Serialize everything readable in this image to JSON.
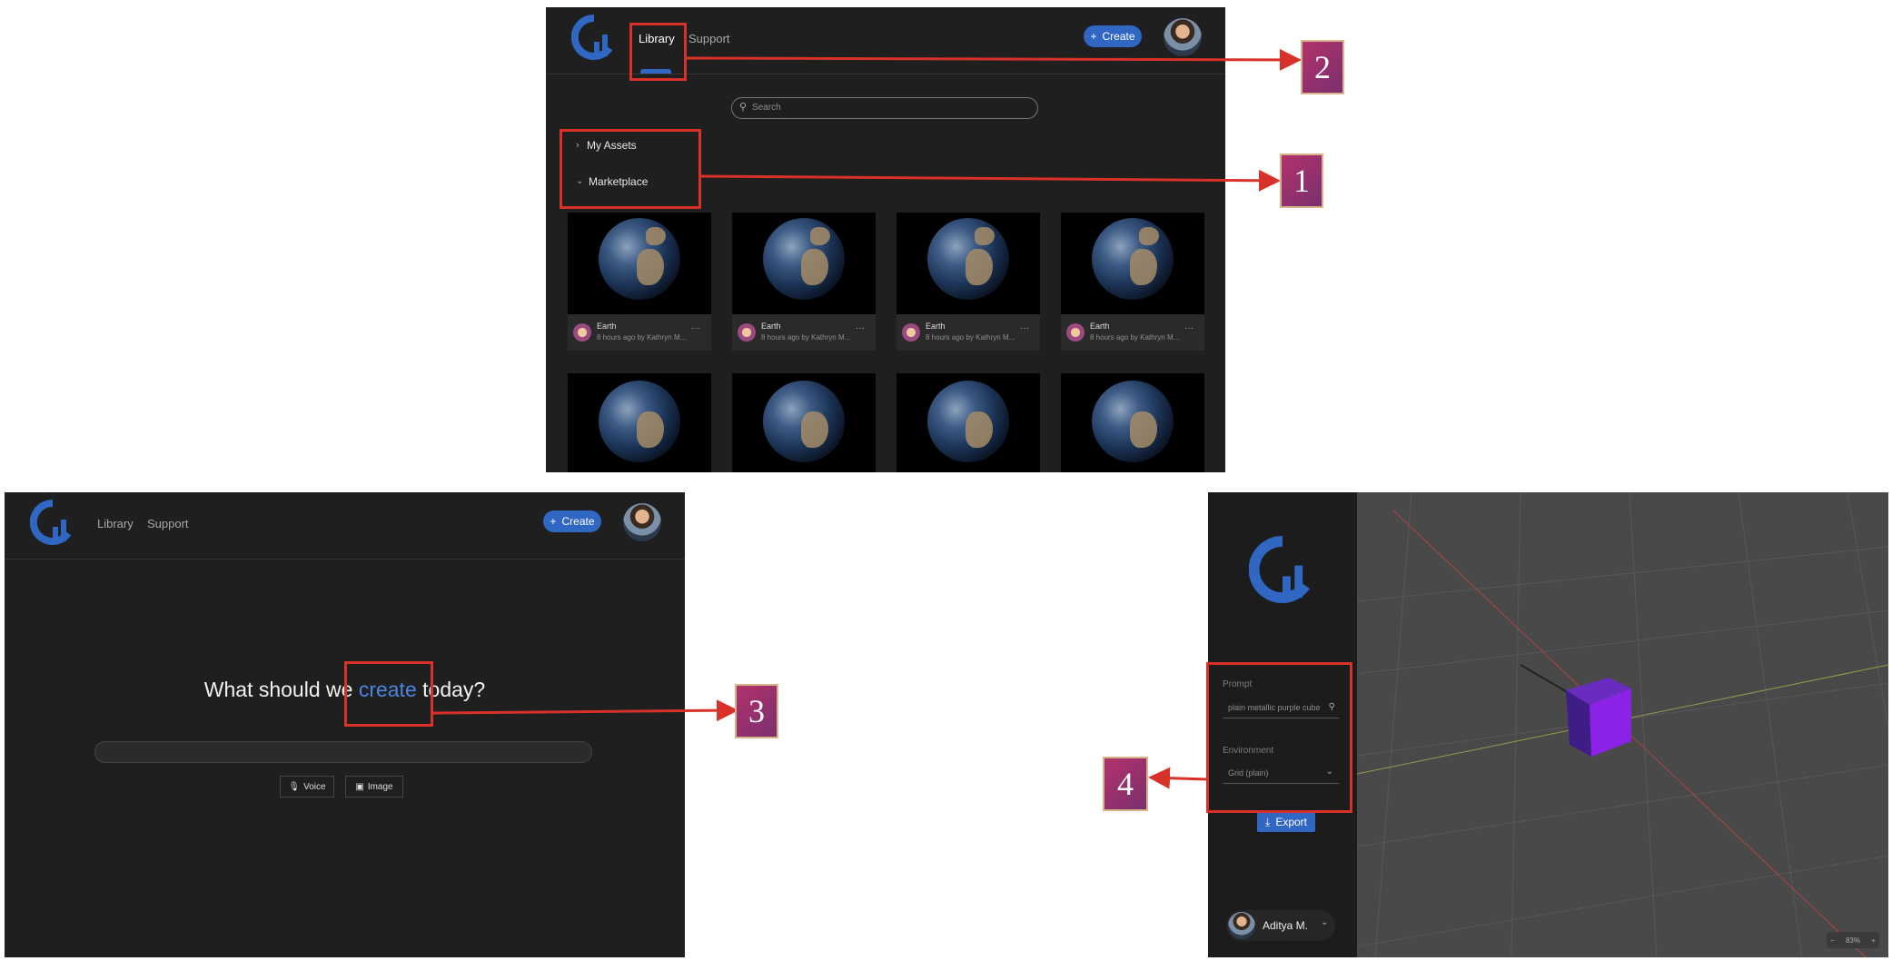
{
  "colors": {
    "accent": "#2f67c2",
    "callout": "#d8312a",
    "panel_bg": "#1f1f1f",
    "cube": "#8c22e6"
  },
  "library_screen": {
    "nav": {
      "library": "Library",
      "support": "Support"
    },
    "create_label": "Create",
    "search_placeholder": "Search",
    "sections": {
      "my_assets": "My Assets",
      "marketplace": "Marketplace"
    },
    "tiles": [
      {
        "title": "Earth",
        "subtitle": "8 hours ago by Kathryn M..."
      },
      {
        "title": "Earth",
        "subtitle": "8 hours ago by Kathryn M..."
      },
      {
        "title": "Earth",
        "subtitle": "8 hours ago by Kathryn M..."
      },
      {
        "title": "Earth",
        "subtitle": "8 hours ago by Kathryn M..."
      }
    ]
  },
  "home_screen": {
    "nav": {
      "library": "Library",
      "support": "Support"
    },
    "create_label": "Create",
    "heading": {
      "before": "What should we",
      "highlight": "create",
      "after": "today?"
    },
    "prompt_value": "",
    "voice_label": "Voice",
    "image_label": "Image"
  },
  "editor_screen": {
    "prompt_label": "Prompt",
    "prompt_value": "plain metallic purple cube",
    "environment_label": "Environment",
    "environment_value": "Grid (plain)",
    "export_label": "Export",
    "user_name": "Aditya M.",
    "zoom": "83%"
  },
  "callouts": [
    "1",
    "2",
    "3",
    "4"
  ]
}
